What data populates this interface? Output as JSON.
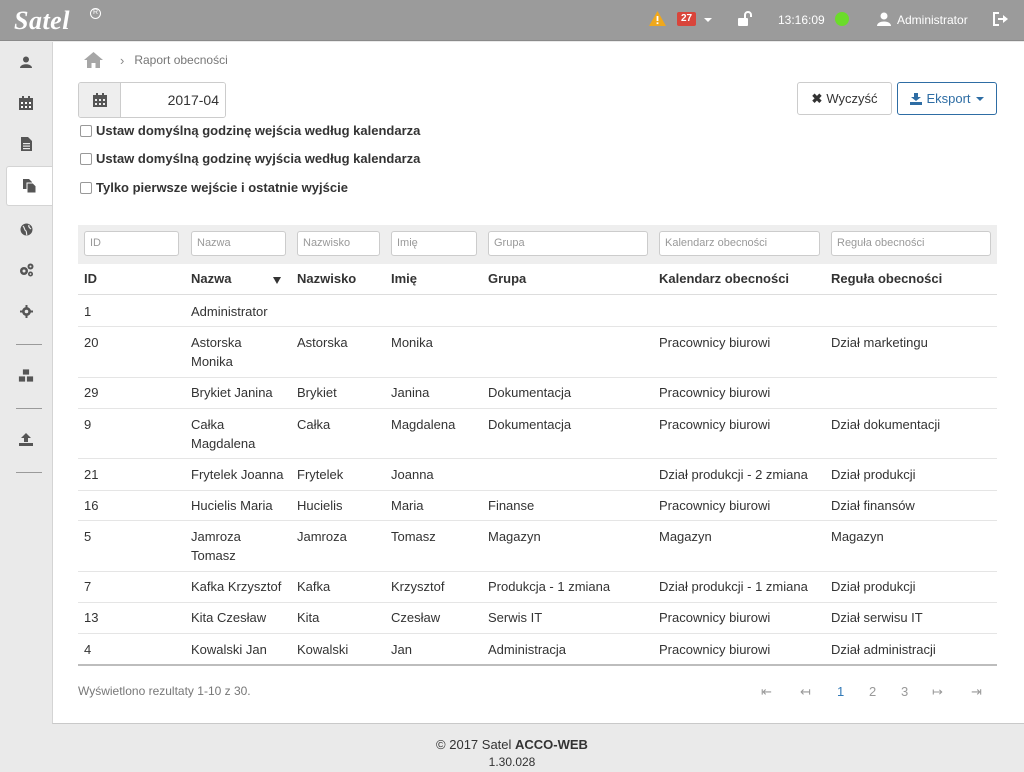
{
  "app": {
    "logo": "Satel",
    "clock": "13:16:09",
    "user": "Administrator",
    "alert_count": "27"
  },
  "breadcrumb": {
    "current": "Raport obecności"
  },
  "date": {
    "value": "2017-04"
  },
  "buttons": {
    "clear": "Wyczyść",
    "export": "Eksport"
  },
  "options": [
    "Ustaw domyślną godzinę wejścia według kalendarza",
    "Ustaw domyślną godzinę wyjścia według kalendarza",
    "Tylko pierwsze wejście i ostatnie wyjście"
  ],
  "filters": [
    "ID",
    "Nazwa",
    "Nazwisko",
    "Imię",
    "Grupa",
    "Kalendarz obecności",
    "Reguła obecności"
  ],
  "columns": [
    "ID",
    "Nazwa",
    "Nazwisko",
    "Imię",
    "Grupa",
    "Kalendarz obecności",
    "Reguła obecności"
  ],
  "rows": [
    [
      "1",
      "Administrator",
      "",
      "",
      "",
      "",
      ""
    ],
    [
      "20",
      "Astorska Monika",
      "Astorska",
      "Monika",
      "",
      "Pracownicy biurowi",
      "Dział marketingu"
    ],
    [
      "29",
      "Brykiet Janina",
      "Brykiet",
      "Janina",
      "Dokumentacja",
      "Pracownicy biurowi",
      ""
    ],
    [
      "9",
      "Całka Magdalena",
      "Całka",
      "Magdalena",
      "Dokumentacja",
      "Pracownicy biurowi",
      "Dział dokumentacji"
    ],
    [
      "21",
      "Frytelek Joanna",
      "Frytelek",
      "Joanna",
      "",
      "Dział produkcji - 2 zmiana",
      "Dział produkcji"
    ],
    [
      "16",
      "Hucielis Maria",
      "Hucielis",
      "Maria",
      "Finanse",
      "Pracownicy biurowi",
      "Dział finansów"
    ],
    [
      "5",
      "Jamroza Tomasz",
      "Jamroza",
      "Tomasz",
      "Magazyn",
      "Magazyn",
      "Magazyn"
    ],
    [
      "7",
      "Kafka Krzysztof",
      "Kafka",
      "Krzysztof",
      "Produkcja - 1 zmiana",
      "Dział produkcji - 1 zmiana",
      "Dział produkcji"
    ],
    [
      "13",
      "Kita Czesław",
      "Kita",
      "Czesław",
      "Serwis IT",
      "Pracownicy biurowi",
      "Dział serwisu IT"
    ],
    [
      "4",
      "Kowalski Jan",
      "Kowalski",
      "Jan",
      "Administracja",
      "Pracownicy biurowi",
      "Dział administracji"
    ]
  ],
  "pagination": {
    "summary": "Wyświetlono rezultaty 1-10 z 30.",
    "first": "⇤",
    "prev": "↤",
    "pages": [
      "1",
      "2",
      "3"
    ],
    "next": "↦",
    "last": "⇥"
  },
  "footer": {
    "copyright": "© 2017 Satel ",
    "product": "ACCO-WEB",
    "version": "1.30.028"
  }
}
